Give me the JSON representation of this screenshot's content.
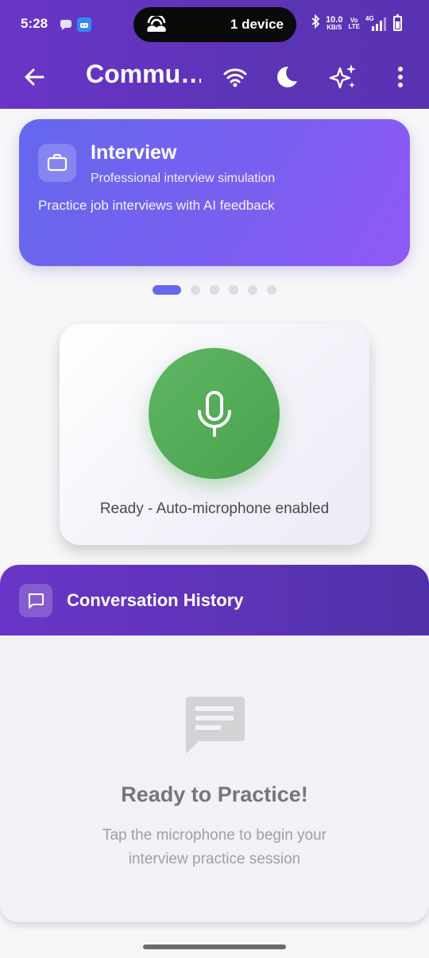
{
  "status_bar": {
    "time": "5:28",
    "hotspot_text": "1 device",
    "net_speed": "10.0",
    "net_unit": "KB/S",
    "volte_top": "Vo",
    "volte_bottom": "LTE",
    "signal_label": "4G"
  },
  "app_bar": {
    "title": "Commu…",
    "back_icon": "arrow-left-icon",
    "actions": [
      "wifi-icon",
      "moon-icon",
      "sparkles-icon",
      "more-vert-icon"
    ]
  },
  "mode_card": {
    "title": "Interview",
    "subtitle": "Professional interview simulation",
    "description": "Practice job interviews with AI feedback",
    "icon": "briefcase-icon",
    "page_count": 6,
    "active_page": 1
  },
  "mic_card": {
    "status": "Ready - Auto-microphone enabled",
    "icon": "microphone-icon",
    "accent_color": "#4caf50"
  },
  "history": {
    "title": "Conversation History",
    "empty_title": "Ready to Practice!",
    "empty_description": "Tap the microphone to begin your interview practice session"
  },
  "colors": {
    "app_bar": "#5b34b6",
    "mode_card_start": "#6468ee",
    "mode_card_end": "#8f5af4"
  }
}
